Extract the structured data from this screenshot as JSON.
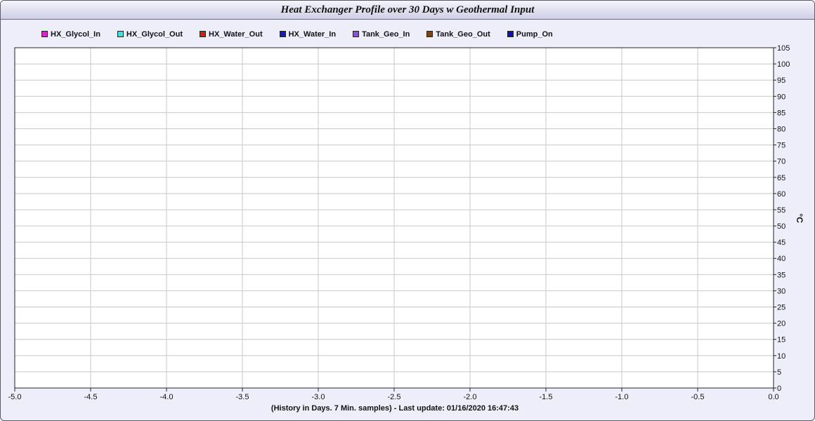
{
  "chart_data": {
    "type": "line",
    "title": "Heat Exchanger Profile over 30 Days w Geothermal Input",
    "xlabel": "(History in Days. 7 Min. samples) - Last update: 01/16/2020 16:47:43",
    "ylabel": "°C",
    "xlim": [
      -5.0,
      0.0
    ],
    "ylim": [
      0,
      105
    ],
    "x_ticks": [
      "-5.0",
      "-4.5",
      "-4.0",
      "-3.5",
      "-3.0",
      "-2.5",
      "-2.0",
      "-1.5",
      "-1.0",
      "-0.5",
      "0.0"
    ],
    "y_ticks": [
      "0",
      "5",
      "10",
      "15",
      "20",
      "25",
      "30",
      "35",
      "40",
      "45",
      "50",
      "55",
      "60",
      "65",
      "70",
      "75",
      "80",
      "85",
      "90",
      "95",
      "100",
      "105"
    ],
    "grid": true,
    "legend_position": "top-left",
    "series": [
      {
        "name": "HX_Glycol_In",
        "color": "#e020d0",
        "values": []
      },
      {
        "name": "HX_Glycol_Out",
        "color": "#40e0e0",
        "values": []
      },
      {
        "name": "HX_Water_Out",
        "color": "#e01818",
        "values": []
      },
      {
        "name": "HX_Water_In",
        "color": "#1818c8",
        "values": []
      },
      {
        "name": "Tank_Geo_In",
        "color": "#8a50e0",
        "values": []
      },
      {
        "name": "Tank_Geo_Out",
        "color": "#7a4418",
        "values": []
      },
      {
        "name": "Pump_On",
        "color": "#1010c0",
        "values": []
      }
    ]
  }
}
